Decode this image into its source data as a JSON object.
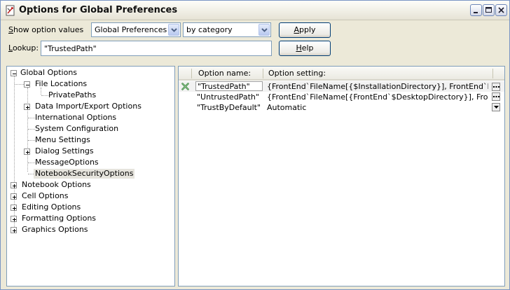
{
  "window": {
    "title": "Options for Global Preferences"
  },
  "toolbar": {
    "show_label_prefix": "S",
    "show_label_rest": "how option values",
    "scope_value": "Global Preferences",
    "sort_value": "by category",
    "apply_prefix": "A",
    "apply_rest": "pply",
    "lookup_prefix": "L",
    "lookup_rest": "ookup:",
    "lookup_value": "\"TrustedPath\"",
    "help_prefix": "H",
    "help_rest": "elp"
  },
  "tree": {
    "items": [
      {
        "label": "Global Options"
      },
      {
        "label": "File Locations"
      },
      {
        "label": "PrivatePaths"
      },
      {
        "label": "Data Import/Export Options"
      },
      {
        "label": "International Options"
      },
      {
        "label": "System Configuration"
      },
      {
        "label": "Menu Settings"
      },
      {
        "label": "Dialog Settings"
      },
      {
        "label": "MessageOptions"
      },
      {
        "label": "NotebookSecurityOptions"
      },
      {
        "label": "Notebook Options"
      },
      {
        "label": "Cell Options"
      },
      {
        "label": "Editing Options"
      },
      {
        "label": "Formatting Options"
      },
      {
        "label": "Graphics Options"
      }
    ]
  },
  "grid": {
    "col_name": "Option name:",
    "col_setting": "Option setting:",
    "rows": [
      {
        "name": "\"TrustedPath\"",
        "setting": "{FrontEnd`FileName[{$InstallationDirectory}], FrontEnd`FileN..."
      },
      {
        "name": "\"UntrustedPath\"",
        "setting": "{FrontEnd`FileName[{FrontEnd`$DesktopDirectory}], FrontEn..."
      },
      {
        "name": "\"TrustByDefault\"",
        "setting": "Automatic"
      }
    ]
  }
}
